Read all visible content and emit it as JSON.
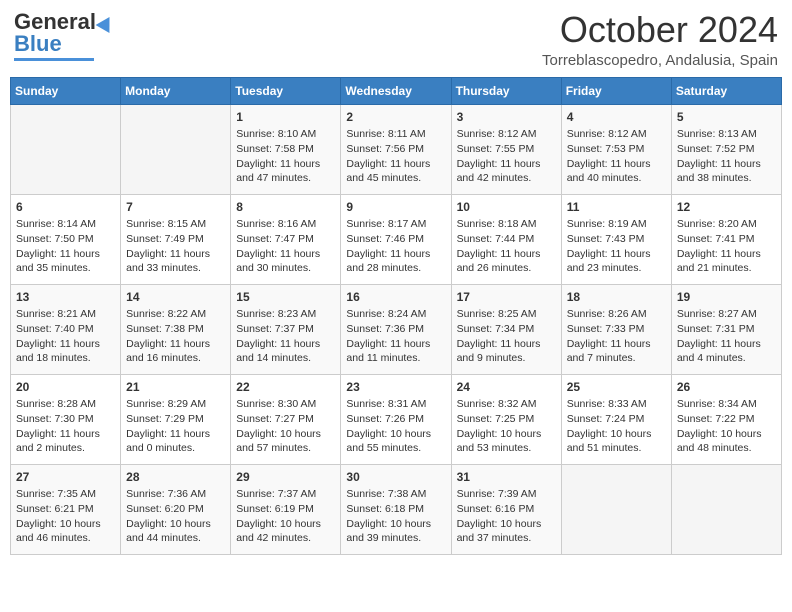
{
  "header": {
    "logo_line1": "General",
    "logo_line2": "Blue",
    "month": "October 2024",
    "location": "Torreblascopedro, Andalusia, Spain"
  },
  "days_of_week": [
    "Sunday",
    "Monday",
    "Tuesday",
    "Wednesday",
    "Thursday",
    "Friday",
    "Saturday"
  ],
  "weeks": [
    [
      {
        "day": "",
        "content": ""
      },
      {
        "day": "",
        "content": ""
      },
      {
        "day": "1",
        "content": "Sunrise: 8:10 AM\nSunset: 7:58 PM\nDaylight: 11 hours and 47 minutes."
      },
      {
        "day": "2",
        "content": "Sunrise: 8:11 AM\nSunset: 7:56 PM\nDaylight: 11 hours and 45 minutes."
      },
      {
        "day": "3",
        "content": "Sunrise: 8:12 AM\nSunset: 7:55 PM\nDaylight: 11 hours and 42 minutes."
      },
      {
        "day": "4",
        "content": "Sunrise: 8:12 AM\nSunset: 7:53 PM\nDaylight: 11 hours and 40 minutes."
      },
      {
        "day": "5",
        "content": "Sunrise: 8:13 AM\nSunset: 7:52 PM\nDaylight: 11 hours and 38 minutes."
      }
    ],
    [
      {
        "day": "6",
        "content": "Sunrise: 8:14 AM\nSunset: 7:50 PM\nDaylight: 11 hours and 35 minutes."
      },
      {
        "day": "7",
        "content": "Sunrise: 8:15 AM\nSunset: 7:49 PM\nDaylight: 11 hours and 33 minutes."
      },
      {
        "day": "8",
        "content": "Sunrise: 8:16 AM\nSunset: 7:47 PM\nDaylight: 11 hours and 30 minutes."
      },
      {
        "day": "9",
        "content": "Sunrise: 8:17 AM\nSunset: 7:46 PM\nDaylight: 11 hours and 28 minutes."
      },
      {
        "day": "10",
        "content": "Sunrise: 8:18 AM\nSunset: 7:44 PM\nDaylight: 11 hours and 26 minutes."
      },
      {
        "day": "11",
        "content": "Sunrise: 8:19 AM\nSunset: 7:43 PM\nDaylight: 11 hours and 23 minutes."
      },
      {
        "day": "12",
        "content": "Sunrise: 8:20 AM\nSunset: 7:41 PM\nDaylight: 11 hours and 21 minutes."
      }
    ],
    [
      {
        "day": "13",
        "content": "Sunrise: 8:21 AM\nSunset: 7:40 PM\nDaylight: 11 hours and 18 minutes."
      },
      {
        "day": "14",
        "content": "Sunrise: 8:22 AM\nSunset: 7:38 PM\nDaylight: 11 hours and 16 minutes."
      },
      {
        "day": "15",
        "content": "Sunrise: 8:23 AM\nSunset: 7:37 PM\nDaylight: 11 hours and 14 minutes."
      },
      {
        "day": "16",
        "content": "Sunrise: 8:24 AM\nSunset: 7:36 PM\nDaylight: 11 hours and 11 minutes."
      },
      {
        "day": "17",
        "content": "Sunrise: 8:25 AM\nSunset: 7:34 PM\nDaylight: 11 hours and 9 minutes."
      },
      {
        "day": "18",
        "content": "Sunrise: 8:26 AM\nSunset: 7:33 PM\nDaylight: 11 hours and 7 minutes."
      },
      {
        "day": "19",
        "content": "Sunrise: 8:27 AM\nSunset: 7:31 PM\nDaylight: 11 hours and 4 minutes."
      }
    ],
    [
      {
        "day": "20",
        "content": "Sunrise: 8:28 AM\nSunset: 7:30 PM\nDaylight: 11 hours and 2 minutes."
      },
      {
        "day": "21",
        "content": "Sunrise: 8:29 AM\nSunset: 7:29 PM\nDaylight: 11 hours and 0 minutes."
      },
      {
        "day": "22",
        "content": "Sunrise: 8:30 AM\nSunset: 7:27 PM\nDaylight: 10 hours and 57 minutes."
      },
      {
        "day": "23",
        "content": "Sunrise: 8:31 AM\nSunset: 7:26 PM\nDaylight: 10 hours and 55 minutes."
      },
      {
        "day": "24",
        "content": "Sunrise: 8:32 AM\nSunset: 7:25 PM\nDaylight: 10 hours and 53 minutes."
      },
      {
        "day": "25",
        "content": "Sunrise: 8:33 AM\nSunset: 7:24 PM\nDaylight: 10 hours and 51 minutes."
      },
      {
        "day": "26",
        "content": "Sunrise: 8:34 AM\nSunset: 7:22 PM\nDaylight: 10 hours and 48 minutes."
      }
    ],
    [
      {
        "day": "27",
        "content": "Sunrise: 7:35 AM\nSunset: 6:21 PM\nDaylight: 10 hours and 46 minutes."
      },
      {
        "day": "28",
        "content": "Sunrise: 7:36 AM\nSunset: 6:20 PM\nDaylight: 10 hours and 44 minutes."
      },
      {
        "day": "29",
        "content": "Sunrise: 7:37 AM\nSunset: 6:19 PM\nDaylight: 10 hours and 42 minutes."
      },
      {
        "day": "30",
        "content": "Sunrise: 7:38 AM\nSunset: 6:18 PM\nDaylight: 10 hours and 39 minutes."
      },
      {
        "day": "31",
        "content": "Sunrise: 7:39 AM\nSunset: 6:16 PM\nDaylight: 10 hours and 37 minutes."
      },
      {
        "day": "",
        "content": ""
      },
      {
        "day": "",
        "content": ""
      }
    ]
  ]
}
